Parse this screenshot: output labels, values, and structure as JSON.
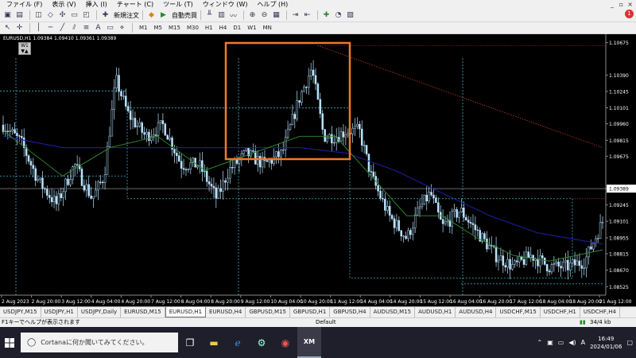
{
  "menu": [
    "ファイル (F)",
    "表示 (V)",
    "挿入 (I)",
    "チャート (C)",
    "ツール (T)",
    "ウィンドウ (W)",
    "ヘルプ (H)"
  ],
  "window_controls": [
    "_",
    "▫",
    "×"
  ],
  "toolbar": {
    "new_order": "新規注文",
    "auto_trade": "自動売買",
    "notification_count": "1"
  },
  "timeframes": [
    "M1",
    "M5",
    "M15",
    "M30",
    "H1",
    "H4",
    "D1",
    "W1",
    "MN"
  ],
  "chart": {
    "title": "EURUSD,H1  1.09384 1.09410 1.09361 1.09389",
    "w1_label": "W1",
    "current_price": "1.09389",
    "colors": {
      "background": "#000000",
      "candle": "#b9e4ff",
      "ma_fast": "#2f8f2f",
      "ma_slow": "#1d1d9a",
      "highlight": "#f07a2a",
      "price_tag": "#ffffff"
    }
  },
  "chart_data": {
    "type": "line",
    "symbol": "EURUSD",
    "timeframe": "H1",
    "y_ticks": [
      "1.10675",
      "1.10390",
      "1.10245",
      "1.10101",
      "1.09960",
      "1.09815",
      "1.09675",
      "1.09389",
      "1.09245",
      "1.09101",
      "1.08955",
      "1.08815",
      "1.08670",
      "1.08525"
    ],
    "x_ticks": [
      "2 Aug 2023",
      "2 Aug 20:00",
      "3 Aug 12:00",
      "4 Aug 04:00",
      "4 Aug 20:00",
      "7 Aug 12:00",
      "8 Aug 04:00",
      "8 Aug 20:00",
      "9 Aug 12:00",
      "10 Aug 04:00",
      "10 Aug 20:00",
      "11 Aug 12:00",
      "14 Aug 04:00",
      "14 Aug 20:00",
      "15 Aug 12:00",
      "16 Aug 04:00",
      "16 Aug 20:00",
      "17 Aug 12:00",
      "18 Aug 04:00",
      "18 Aug 20:00",
      "21 Aug 12:00"
    ],
    "ylim": [
      1.0845,
      1.1075
    ],
    "price_path": [
      [
        0,
        1.0995
      ],
      [
        3,
        1.098
      ],
      [
        6,
        1.0945
      ],
      [
        9,
        1.0925
      ],
      [
        12,
        1.096
      ],
      [
        15,
        1.093
      ],
      [
        17,
        1.095
      ],
      [
        19,
        1.1035
      ],
      [
        21,
        1.1005
      ],
      [
        24,
        1.0985
      ],
      [
        27,
        1.0995
      ],
      [
        30,
        1.096
      ],
      [
        33,
        1.096
      ],
      [
        36,
        1.093
      ],
      [
        38,
        1.0955
      ],
      [
        41,
        1.097
      ],
      [
        44,
        1.096
      ],
      [
        47,
        1.097
      ],
      [
        50,
        1.102
      ],
      [
        52,
        1.1045
      ],
      [
        54,
        1.0985
      ],
      [
        56,
        1.0985
      ],
      [
        58,
        1.099
      ],
      [
        60,
        1.099
      ],
      [
        62,
        1.095
      ],
      [
        65,
        1.0915
      ],
      [
        68,
        1.0895
      ],
      [
        70,
        1.092
      ],
      [
        72,
        1.0935
      ],
      [
        74,
        1.0905
      ],
      [
        77,
        1.092
      ],
      [
        80,
        1.09
      ],
      [
        83,
        1.088
      ],
      [
        86,
        1.087
      ],
      [
        89,
        1.088
      ],
      [
        92,
        1.087
      ],
      [
        95,
        1.087
      ],
      [
        98,
        1.0875
      ],
      [
        101,
        1.091
      ]
    ],
    "ma_fast": [
      [
        0,
        1.099
      ],
      [
        10,
        1.095
      ],
      [
        18,
        1.0975
      ],
      [
        26,
        1.0985
      ],
      [
        34,
        1.0955
      ],
      [
        42,
        1.097
      ],
      [
        50,
        1.0985
      ],
      [
        56,
        1.0985
      ],
      [
        62,
        1.095
      ],
      [
        68,
        1.0915
      ],
      [
        74,
        1.0915
      ],
      [
        80,
        1.0895
      ],
      [
        86,
        1.088
      ],
      [
        92,
        1.0875
      ],
      [
        101,
        1.0885
      ]
    ],
    "ma_slow": [
      [
        0,
        1.0985
      ],
      [
        10,
        1.0975
      ],
      [
        20,
        1.0975
      ],
      [
        30,
        1.0975
      ],
      [
        40,
        1.0975
      ],
      [
        50,
        1.0975
      ],
      [
        58,
        1.097
      ],
      [
        66,
        1.0955
      ],
      [
        74,
        1.0935
      ],
      [
        82,
        1.0915
      ],
      [
        90,
        1.09
      ],
      [
        101,
        1.089
      ]
    ],
    "trend_line": [
      [
        53,
        1.1065
      ],
      [
        101,
        1.0975
      ]
    ]
  },
  "tabs": [
    "USDJPY,M15",
    "USDJPY,H1",
    "USDJPY,Daily",
    "EURUSD,M15",
    "EURUSD,H1",
    "EURUSD,H4",
    "GBPUSD,M15",
    "GBPUSD,H1",
    "GBPUSD,H4",
    "AUDUSD,M15",
    "AUDUSD,H1",
    "AUDUSD,H4",
    "USDCHF,M15",
    "USDCHF,H1",
    "USDCHF,H4"
  ],
  "active_tab": "EURUSD,H1",
  "status": {
    "help": "F1キーでヘルプが表示されます",
    "profile": "Default",
    "traffic": "34/4 kb"
  },
  "taskbar": {
    "search_placeholder": "Cortanaに何か聞いてみてください。",
    "time": "16:49",
    "date": "2024/01/06",
    "lang": "A"
  }
}
